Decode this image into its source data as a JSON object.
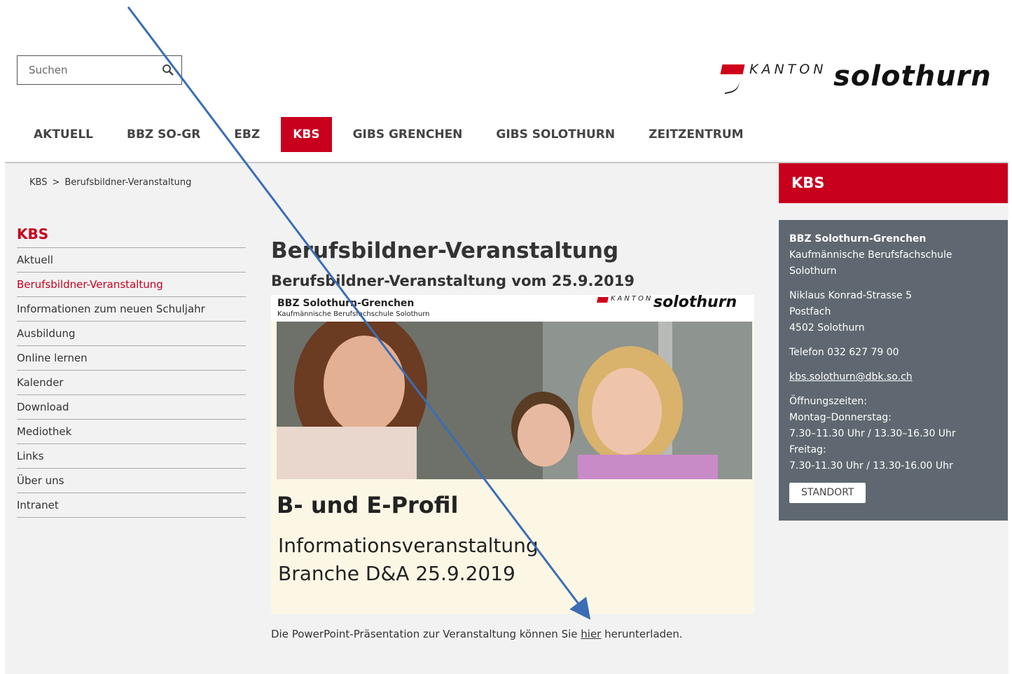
{
  "search": {
    "placeholder": "Suchen"
  },
  "logo": {
    "kanton": "KANTON",
    "name": "solothurn"
  },
  "nav": [
    {
      "label": "AKTUELL"
    },
    {
      "label": "BBZ SO-GR"
    },
    {
      "label": "EBZ"
    },
    {
      "label": "KBS",
      "active": true
    },
    {
      "label": "GIBS GRENCHEN"
    },
    {
      "label": "GIBS SOLOTHURN"
    },
    {
      "label": "ZEITZENTRUM"
    }
  ],
  "breadcrumb": {
    "root": "KBS",
    "separator": ">",
    "current": "Berufsbildner-Veranstaltung"
  },
  "sidebar": {
    "title": "KBS",
    "items": [
      {
        "label": "Aktuell"
      },
      {
        "label": "Berufsbildner-Veranstaltung",
        "active": true
      },
      {
        "label": "Informationen zum neuen Schuljahr"
      },
      {
        "label": "Ausbildung"
      },
      {
        "label": "Online lernen"
      },
      {
        "label": "Kalender"
      },
      {
        "label": "Download"
      },
      {
        "label": "Mediothek"
      },
      {
        "label": "Links"
      },
      {
        "label": "Über uns"
      },
      {
        "label": "Intranet"
      }
    ]
  },
  "main": {
    "title": "Berufsbildner-Veranstaltung",
    "subtitle": "Berufsbildner-Veranstaltung vom 25.9.2019",
    "banner": {
      "org": "BBZ Solothurn-Grenchen",
      "org_sub": "Kaufmännische Berufsfachschule Solothurn",
      "logo_kanton": "KANTON",
      "logo_name": "solothurn",
      "profile": "B- und E-Profil",
      "info_line1": "Informationsveranstaltung",
      "info_line2": "Branche D&A 25.9.2019"
    },
    "note_before": "Die PowerPoint-Präsentation zur Veranstaltung können Sie ",
    "note_link": "hier",
    "note_after": " herunterladen."
  },
  "right": {
    "header": "KBS",
    "org": "BBZ Solothurn-Grenchen",
    "org_line2": "Kaufmännische Berufsfachschule",
    "org_line3": "Solothurn",
    "street": "Niklaus Konrad-Strasse 5",
    "postfach": "Postfach",
    "city": "4502 Solothurn",
    "phone": "Telefon 032 627 79 00",
    "email": "kbs.solothurn@dbk.so.ch",
    "hours_label": "Öffnungszeiten:",
    "hours_days1": "Montag–Donnerstag:",
    "hours_time1": "7.30–11.30 Uhr / 13.30–16.30 Uhr",
    "hours_days2": "Freitag:",
    "hours_time2": "7.30-11.30 Uhr / 13.30-16.00 Uhr",
    "button": "STANDORT"
  },
  "colors": {
    "accent": "#c8001e",
    "panel": "#5f6870",
    "annotation_arrow": "#3b6db5"
  }
}
